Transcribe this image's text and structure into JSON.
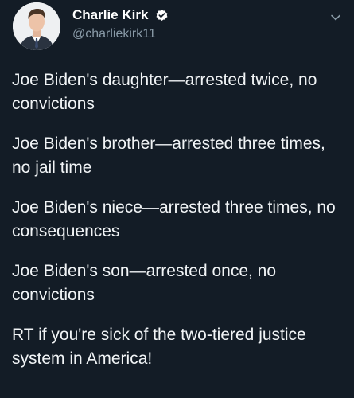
{
  "tweet": {
    "author": {
      "display_name": "Charlie Kirk",
      "handle": "@charliekirk11",
      "verified": true
    },
    "menu_icon": "chevron-down-icon",
    "paragraphs": [
      "Joe Biden's daughter—arrested twice, no convictions",
      "Joe Biden's brother—arrested three times, no jail time",
      "Joe Biden's niece—arrested three times, no consequences",
      "Joe Biden's son—arrested once, no convictions",
      "RT if you're sick of the two-tiered justice system in America!"
    ]
  },
  "colors": {
    "background": "#131c26",
    "text": "#f1f4f6",
    "secondary_text": "#8899a6",
    "verified_badge": "#1da1f2"
  }
}
